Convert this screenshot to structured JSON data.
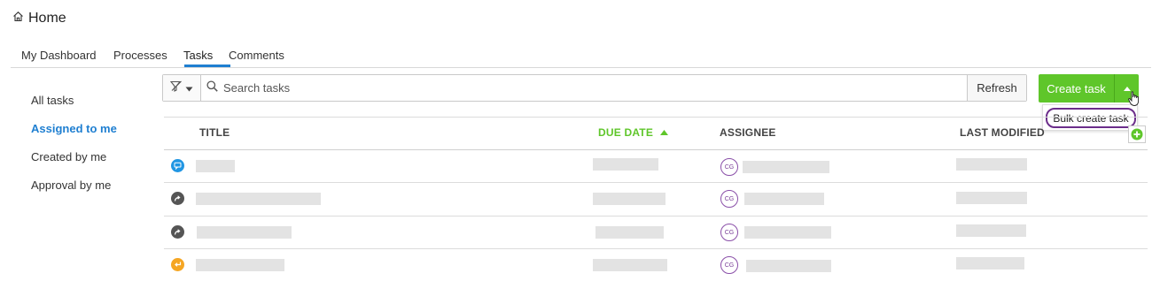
{
  "header": {
    "title": "Home",
    "icon": "home-icon"
  },
  "tabs": [
    {
      "label": "My Dashboard",
      "active": false
    },
    {
      "label": "Processes",
      "active": false
    },
    {
      "label": "Tasks",
      "active": true
    },
    {
      "label": "Comments",
      "active": false
    }
  ],
  "sidebar": {
    "items": [
      {
        "label": "All tasks",
        "active": false
      },
      {
        "label": "Assigned to me",
        "active": true
      },
      {
        "label": "Created by me",
        "active": false
      },
      {
        "label": "Approval by me",
        "active": false
      }
    ]
  },
  "toolbar": {
    "search_placeholder": "Search tasks",
    "refresh_label": "Refresh",
    "create_label": "Create task",
    "dropdown_item": "Bulk create task"
  },
  "table": {
    "columns": {
      "title": "TITLE",
      "due_date": "DUE DATE",
      "assignee": "ASSIGNEE",
      "last_modified": "LAST MODIFIED"
    },
    "sort": {
      "column": "due_date",
      "direction": "ascending"
    },
    "rows": [
      {
        "icon": "comment-icon",
        "icon_color": "#2196e3",
        "assignee_initials": "CG"
      },
      {
        "icon": "forward-arrow-icon",
        "icon_color": "#555555",
        "assignee_initials": "CG"
      },
      {
        "icon": "forward-arrow-icon",
        "icon_color": "#555555",
        "assignee_initials": "CG"
      },
      {
        "icon": "return-arrow-icon",
        "icon_color": "#f5a623",
        "assignee_initials": "CG"
      }
    ]
  },
  "colors": {
    "accent_blue": "#1f7fd1",
    "accent_green": "#5fc62a",
    "avatar_purple": "#8a4fa8"
  }
}
